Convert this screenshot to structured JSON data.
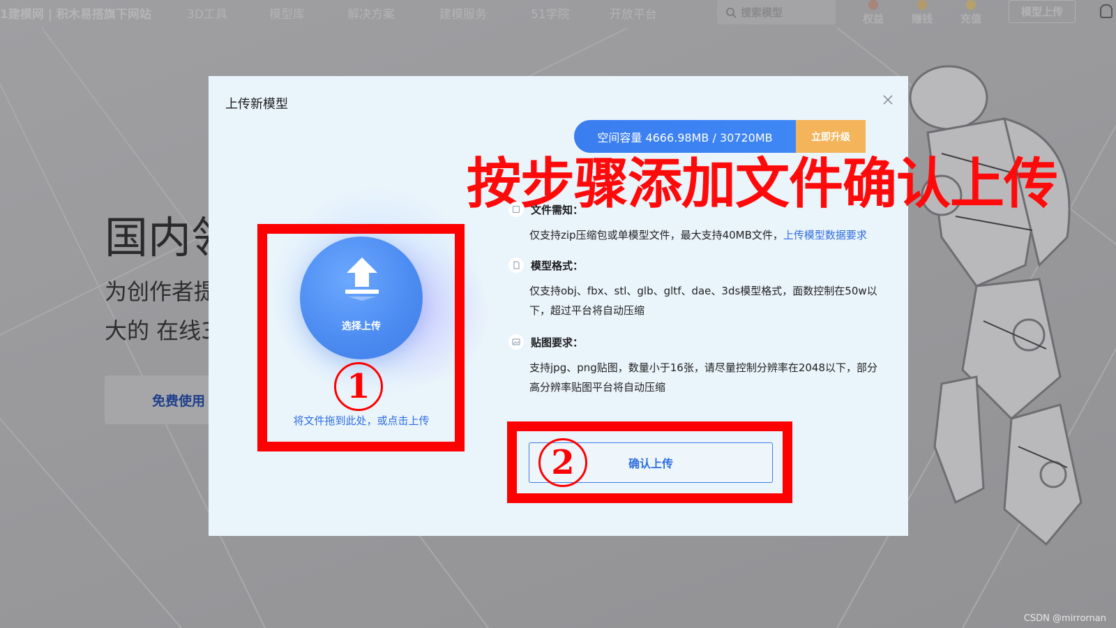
{
  "site": {
    "brand": "1建模网 | 积木易搭旗下网站",
    "nav": [
      "3D工具",
      "模型库",
      "解决方案",
      "建模服务",
      "51学院",
      "开放平台"
    ],
    "search_placeholder": "搜索模型",
    "top_icons": [
      {
        "label": "权益",
        "icon": "star-badge-icon"
      },
      {
        "label": "赚钱",
        "icon": "coin-icon"
      },
      {
        "label": "充值",
        "icon": "gift-icon"
      }
    ],
    "upload_button": "模型上传",
    "hero_title": "国内领",
    "hero_sub_line1": "为创作者提",
    "hero_sub_line2": "大的 在线3",
    "hero_button": "免费使用"
  },
  "modal": {
    "title": "上传新模型",
    "capacity": "空间容量 4666.98MB / 30720MB",
    "upgrade": "立即升级",
    "annotation_banner": "按步骤添加文件确认上传",
    "upload_circle_label": "选择上传",
    "step1": "1",
    "step2": "2",
    "drag_hint": "将文件拖到此处，或点击上传",
    "requirements": [
      {
        "title": "文件需知：",
        "text": "仅支持zip压缩包或单模型文件，最大支持40MB文件，",
        "link": "上传模型数据要求"
      },
      {
        "title": "模型格式：",
        "text": "仅支持obj、fbx、stl、glb、gltf、dae、3ds模型格式，面数控制在50w以下，超过平台将自动压缩"
      },
      {
        "title": "贴图要求：",
        "text": "支持jpg、png贴图，数量小于16张，请尽量控制分辨率在2048以下，部分高分辨率贴图平台将自动压缩"
      }
    ],
    "confirm": "确认上传"
  },
  "watermark": "CSDN @mirrornan",
  "colors": {
    "accent": "#2f6ee0",
    "capacity_bar": "#3f87f5",
    "upgrade": "#f4b45a",
    "annotation_red": "#ff0000",
    "modal_bg": "#eaf4fb"
  }
}
